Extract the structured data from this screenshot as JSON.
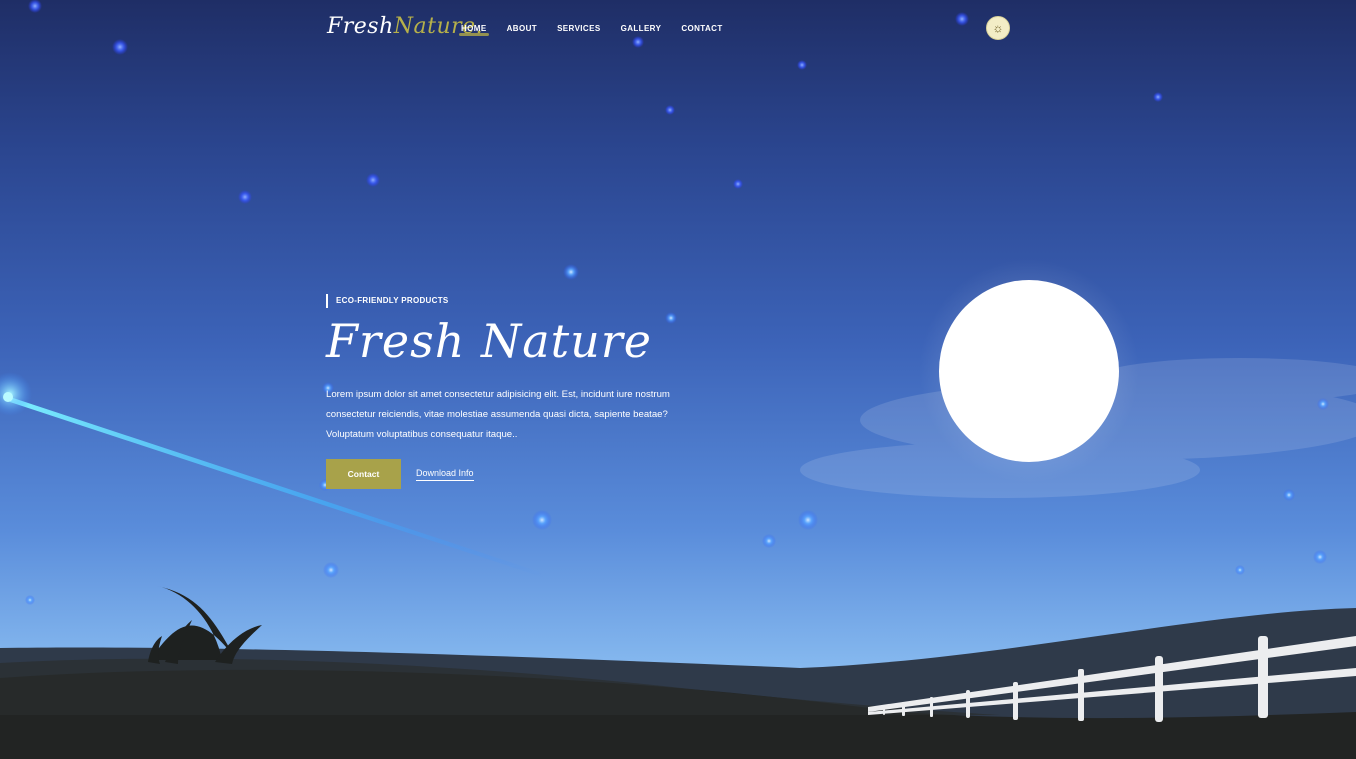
{
  "brand": {
    "logo_part1": "Fresh",
    "logo_part2": "Nature.",
    "accent_color": "#a8a24a"
  },
  "nav": {
    "items": [
      {
        "label": "HOME",
        "active": true
      },
      {
        "label": "ABOUT",
        "active": false
      },
      {
        "label": "SERVICES",
        "active": false
      },
      {
        "label": "GALLERY",
        "active": false
      },
      {
        "label": "CONTACT",
        "active": false
      }
    ],
    "theme_toggle_icon": "sun-icon",
    "theme_toggle_glyph": "☼"
  },
  "hero": {
    "eyebrow": "ECO-FRIENDLY PRODUCTS",
    "title": "Fresh Nature",
    "description": "Lorem ipsum dolor sit amet consectetur adipisicing elit. Est, incidunt iure nostrum consectetur reiciendis, vitae molestiae assumenda quasi dicta, sapiente beatae? Voluptatum voluptatibus consequatur itaque..",
    "contact_button": "Contact",
    "download_link": "Download Info"
  },
  "scene": {
    "moon_color": "#ffffff",
    "sky_top_color": "#1f2e66",
    "sky_bottom_color": "#9cc9f4",
    "ground_color": "#222423",
    "fence_color": "#ecedef"
  }
}
